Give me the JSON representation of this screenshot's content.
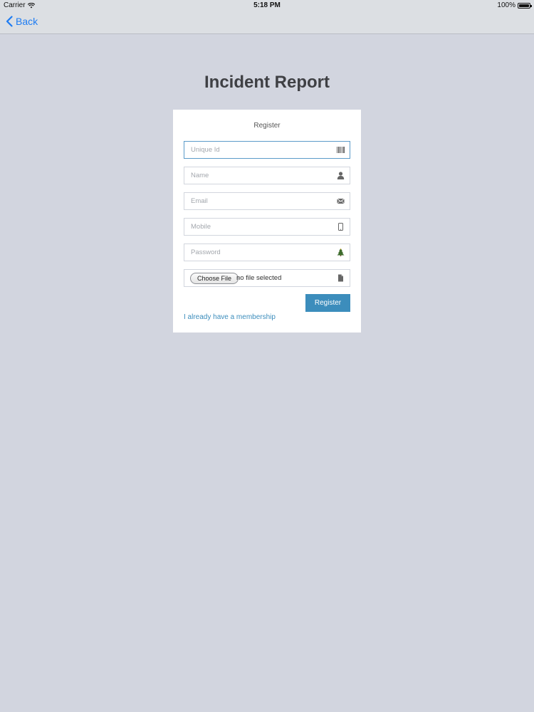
{
  "status_bar": {
    "carrier": "Carrier",
    "time": "5:18 PM",
    "battery": "100%",
    "battery_level": 1.0
  },
  "nav": {
    "back_label": "Back",
    "accent_color": "#1e7cf2"
  },
  "page": {
    "title": "Incident Report"
  },
  "form": {
    "title": "Register",
    "fields": [
      {
        "name": "unique-id",
        "placeholder": "Unique Id",
        "value": "",
        "icon": "barcode-icon",
        "focused": true
      },
      {
        "name": "name",
        "placeholder": "Name",
        "value": "",
        "icon": "user-icon"
      },
      {
        "name": "email",
        "placeholder": "Email",
        "value": "",
        "icon": "envelope-icon"
      },
      {
        "name": "mobile",
        "placeholder": "Mobile",
        "value": "",
        "icon": "mobile-phone-icon"
      },
      {
        "name": "password",
        "placeholder": "Password",
        "value": "",
        "icon": "tree-icon"
      }
    ],
    "file": {
      "button_label": "Choose File",
      "status": "no file selected",
      "icon": "file-icon"
    },
    "submit_label": "Register",
    "submit_color": "#3c8dbc",
    "membership_link": "I already have a membership"
  }
}
